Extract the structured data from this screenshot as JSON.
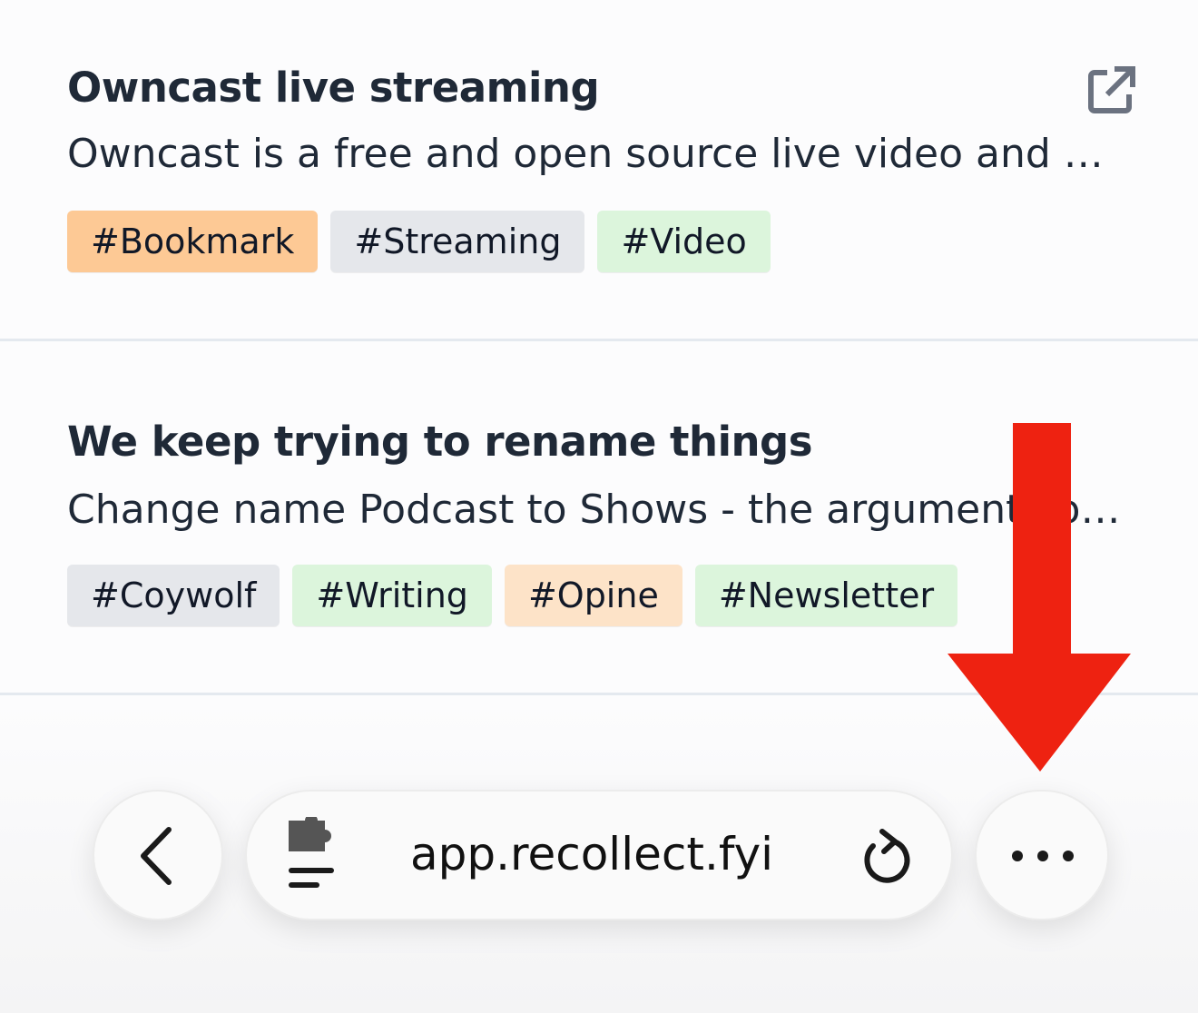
{
  "items": [
    {
      "title": "Owncast live streaming",
      "description": "Owncast is a free and open source live video and web chat server for use with existing popular broadcasting software.",
      "tags": [
        {
          "label": "#Bookmark",
          "color": "#fdc995"
        },
        {
          "label": "#Streaming",
          "color": "#e5e7eb"
        },
        {
          "label": "#Video",
          "color": "#dcf5dc"
        }
      ],
      "icon": "external-link-icon"
    },
    {
      "title": "We keep trying to rename things",
      "description": "Change name Podcast to Shows - the argument continues",
      "tags": [
        {
          "label": "#Coywolf",
          "color": "#e5e7eb"
        },
        {
          "label": "#Writing",
          "color": "#dcf5dc"
        },
        {
          "label": "#Opine",
          "color": "#fde3c8"
        },
        {
          "label": "#Newsletter",
          "color": "#dcf5dc"
        }
      ]
    }
  ],
  "browser": {
    "url": "app.recollect.fyi",
    "back_icon": "chevron-left-icon",
    "site_icon": "extension-puzzle-icon",
    "reload_icon": "reload-icon",
    "more_icon": "more-dots-icon"
  },
  "annotation": {
    "arrow_color": "#ee2211",
    "icon": "down-arrow-icon"
  }
}
